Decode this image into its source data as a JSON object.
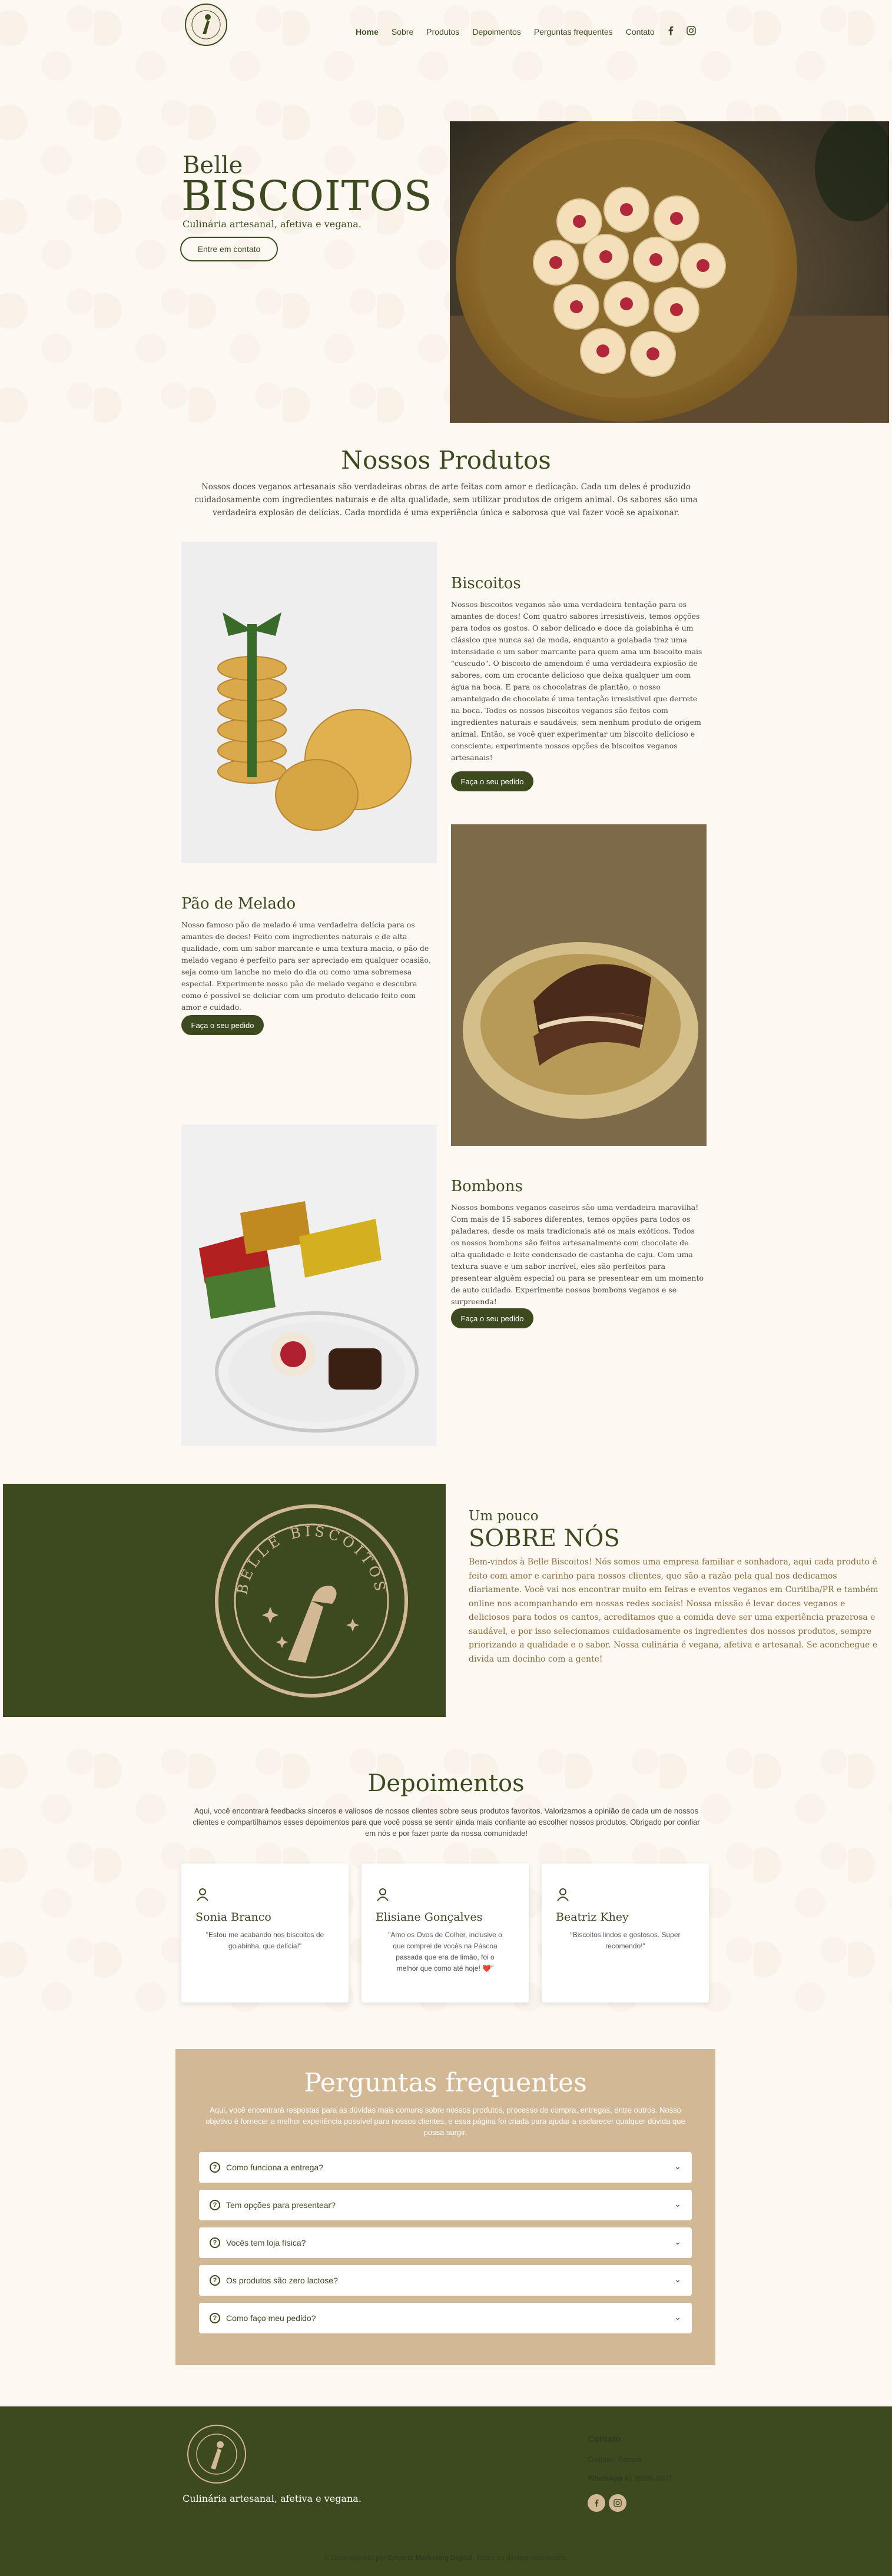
{
  "nav": {
    "items": [
      "Home",
      "Sobre",
      "Produtos",
      "Depoimentos",
      "Perguntas frequentes",
      "Contato"
    ],
    "social_icons": [
      "facebook-icon",
      "instagram-icon"
    ]
  },
  "hero": {
    "subtitle": "Belle",
    "title": "BISCOITOS",
    "tagline": "Culinária artesanal, afetiva e vegana.",
    "button": "Entre em contato"
  },
  "products": {
    "title": "Nossos Produtos",
    "intro": "Nossos doces veganos artesanais são verdadeiras obras de arte feitas com amor e dedicação. Cada um deles é produzido cuidadosamente com ingredientes naturais e de alta qualidade, sem utilizar produtos de origem animal. Os sabores são uma verdadeira explosão de delícias. Cada mordida é uma experiência única e saborosa que vai fazer você se apaixonar.",
    "items": [
      {
        "name": "Biscoitos",
        "text": "Nossos biscoitos veganos são uma verdadeira tentação para os amantes de doces! Com quatro sabores irresistíveis, temos opções para todos os gostos. O sabor delicado e doce da goiabinha é um clássico que nunca sai de moda, enquanto a goiabada traz uma intensidade e um sabor marcante para quem ama um biscoito mais \"cuscudo\". O biscoito de amendoim é uma verdadeira explosão de sabores, com um crocante delicioso que deixa qualquer um com água na boca. E para os chocolatras de plantão, o nosso amanteigado de chocolate é uma tentação irresistível que derrete na boca. Todos os nossos biscoitos veganos são feitos com ingredientes naturais e saudáveis, sem nenhum produto de origem animal. Então, se você quer experimentar um biscoito delicioso e consciente, experimente nossos opções de biscoitos veganos artesanais!",
        "button": "Faça o seu pedido"
      },
      {
        "name": "Pão de Melado",
        "text": "Nosso famoso pão de melado é uma verdadeira delícia para os amantes de doces! Feito com ingredientes naturais e de alta qualidade, com um sabor marcante e uma textura macia, o pão de melado vegano é perfeito para ser apreciado em qualquer ocasião, seja como um lanche no meio do dia ou como uma sobremesa especial. Experimente nosso pão de melado vegano e descubra como é possível se deliciar com um produto delicado feito com amor e cuidado.",
        "button": "Faça o seu pedido"
      },
      {
        "name": "Bombons",
        "text": "Nossos bombons veganos caseiros são uma verdadeira maravilha! Com mais de 15 sabores diferentes, temos opções para todos os paladares, desde os mais tradicionais até os mais exóticos. Todos os nossos bombons são feitos artesanalmente com chocolate de alta qualidade e leite condensado de castanha de caju. Com uma textura suave e um sabor incrível, eles são perfeitos para presentear alguém especial ou para se presentear em um momento de auto cuidado. Experimente nossos bombons veganos e se surpreenda!",
        "button": "Faça o seu pedido"
      }
    ]
  },
  "about": {
    "logo_text": "BELLE BISCOITOS",
    "subtitle": "Um pouco",
    "title": "SOBRE NÓS",
    "text": "Bem-vindos à Belle Biscoitos! Nós somos uma empresa familiar e sonhadora, aqui cada produto é feito com amor e carinho para nossos clientes, que são a razão pela qual nos dedicamos diariamente. Você vai nos encontrar muito em feiras e eventos veganos em Curitiba/PR e também online nos acompanhando em nossas redes sociais! Nossa missão é levar doces veganos e deliciosos para todos os cantos, acreditamos que a comida deve ser uma experiência prazerosa e saudável, e por isso selecionamos cuidadosamente os ingredientes dos nossos produtos, sempre priorizando a qualidade e o sabor. Nossa culinária é vegana, afetiva e artesanal. Se aconchegue e divida um docinho com a gente!"
  },
  "testimonials": {
    "title": "Depoimentos",
    "intro": "Aqui, você encontrará feedbacks sinceros e valiosos de nossos clientes sobre seus produtos favoritos. Valorizamos a opinião de cada um de nossos clientes e compartilhamos esses depoimentos para que você possa se sentir ainda mais confiante ao escolher nossos produtos. Obrigado por confiar em nós e por fazer parte da nossa comunidade!",
    "cards": [
      {
        "name": "Sonia Branco",
        "quote": "\"Estou me acabando nos biscoitos de goiabinha, que delícia!\""
      },
      {
        "name": "Elisiane Gonçalves",
        "quote": "\"Amo os Ovos de Colher, inclusive o que comprei de vocês na Páscoa passada que era de limão, foi o melhor que como até hoje! ❤️\""
      },
      {
        "name": "Beatriz Khey",
        "quote": "\"Biscoitos lindos e gostosos. Super recomendo!\""
      }
    ]
  },
  "faq": {
    "title": "Perguntas frequentes",
    "intro": "Aqui, você encontrará respostas para as dúvidas mais comuns sobre nossos produtos, processo de compra, entregas, entre outros. Nosso objetivo é fornecer a melhor experiência possível para nossos clientes, e essa página foi criada para ajudar a esclarecer qualquer dúvida que possa surgir.",
    "items": [
      "Como funciona a entrega?",
      "Tem opções para presentear?",
      "Vocês tem loja física?",
      "Os produtos são zero lactose?",
      "Como faço meu pedido?"
    ]
  },
  "footer": {
    "tagline": "Culinária artesanal, afetiva e vegana.",
    "contact_title": "Contato",
    "city": "Curitiba - Paraná",
    "whatsapp_label": "WhatsApp",
    "whatsapp_number": "41 99996-8637",
    "copyright_prefix": "© Desenvolvido por ",
    "copyright_brand": "Empiriz Marketing Digital",
    "copyright_suffix": ". Todos os direitos reservados."
  },
  "colors": {
    "primary": "#3d4a20",
    "accent": "#d3b896",
    "background": "#fdf8f2"
  }
}
